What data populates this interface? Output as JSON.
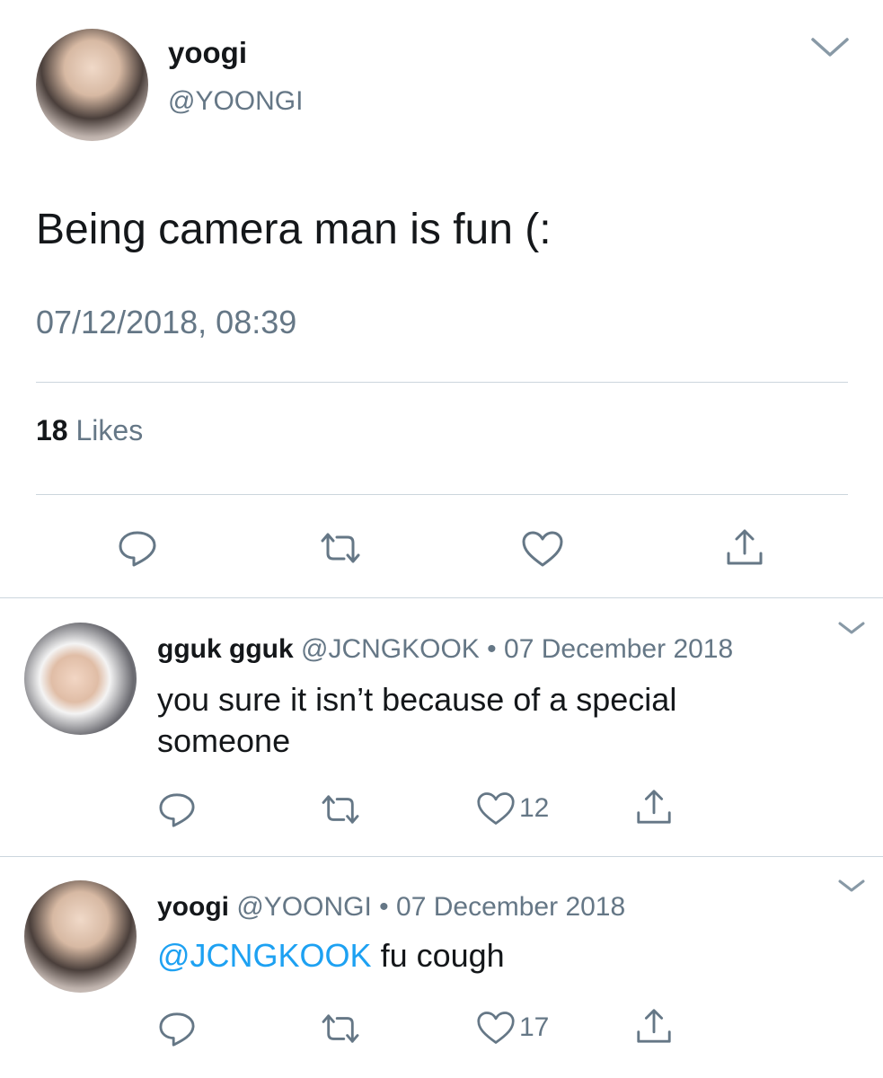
{
  "main_tweet": {
    "display_name": "yoogi",
    "handle": "@YOONGI",
    "text": "Being camera man is fun (:",
    "timestamp": "07/12/2018, 08:39",
    "likes_count": "18",
    "likes_label": "Likes"
  },
  "replies": [
    {
      "display_name": "gguk gguk",
      "handle": "@JCNGKOOK",
      "separator": "•",
      "date": "07 December 2018",
      "text_line1": "you sure it isn’t because of a special",
      "text_line2": "someone",
      "like_count": "12"
    },
    {
      "display_name": "yoogi",
      "handle": "@YOONGI",
      "separator": "•",
      "date": "07 December 2018",
      "mention": "@JCNGKOOK",
      "text": " fu cough",
      "like_count": "17"
    }
  ],
  "icons": [
    "chevron-down-icon",
    "reply-icon",
    "retweet-icon",
    "like-icon",
    "share-icon"
  ],
  "colors": {
    "text": "#14171a",
    "secondary": "#657786",
    "link": "#1da1f2",
    "divider": "#ccd6dd"
  }
}
